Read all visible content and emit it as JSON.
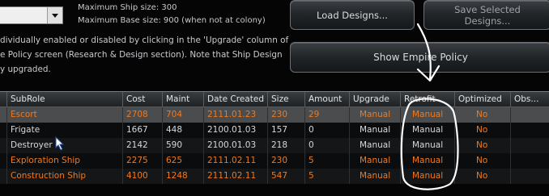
{
  "size_info": {
    "max_ship": "Maximum Ship size: 300",
    "max_base": "Maximum Base size: 900 (when not at colony)"
  },
  "note_lines": [
    "dividually enabled or disabled by clicking in the 'Upgrade' column of",
    "e Policy screen (Research & Design section). Note that Ship Design",
    "y upgraded."
  ],
  "buttons": {
    "load": "Load Designs...",
    "save_line1": "Save Selected",
    "save_line2": "Designs...",
    "policy": "Show Empire Policy"
  },
  "table": {
    "headers": [
      "SubRole",
      "Cost",
      "Maint",
      "Date Created",
      "Size",
      "Amount",
      "Upgrade",
      "Retrofit",
      "Optimized",
      "Obs..."
    ],
    "rows": [
      {
        "subrole": "Escort",
        "cost": "2708",
        "maint": "704",
        "date": "2111.01.23",
        "size": "230",
        "amount": "29",
        "upgrade": "Manual",
        "retrofit": "Manual",
        "optimized": "No"
      },
      {
        "subrole": "Frigate",
        "cost": "1667",
        "maint": "448",
        "date": "2100.01.03",
        "size": "157",
        "amount": "0",
        "upgrade": "Manual",
        "retrofit": "Manual",
        "optimized": "No"
      },
      {
        "subrole": "Destroyer",
        "cost": "2142",
        "maint": "590",
        "date": "2100.01.03",
        "size": "218",
        "amount": "0",
        "upgrade": "Manual",
        "retrofit": "Manual",
        "optimized": "No"
      },
      {
        "subrole": "Exploration Ship",
        "cost": "2275",
        "maint": "625",
        "date": "2111.02.11",
        "size": "230",
        "amount": "5",
        "upgrade": "Manual",
        "retrofit": "Manual",
        "optimized": "No"
      },
      {
        "subrole": "Construction Ship",
        "cost": "4100",
        "maint": "1248",
        "date": "2111.02.11",
        "size": "547",
        "amount": "5",
        "upgrade": "Manual",
        "retrofit": "Manual",
        "optimized": "No"
      }
    ]
  },
  "colors": {
    "accent_orange": "#f07a1e",
    "annotation": "#ffffff",
    "selected_row": "#4a4c4e"
  },
  "icons": [
    "dropdown-arrow-icon",
    "mouse-cursor-icon"
  ]
}
